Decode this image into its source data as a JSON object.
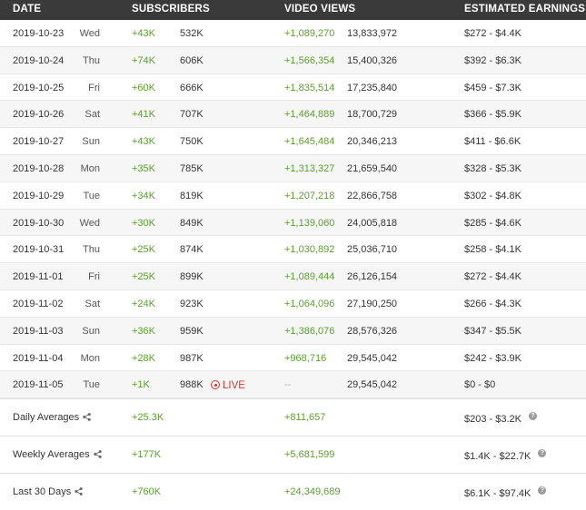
{
  "header": {
    "date": "DATE",
    "subscribers": "SUBSCRIBERS",
    "video_views": "VIDEO VIEWS",
    "estimated_earnings": "ESTIMATED EARNINGS"
  },
  "rows": [
    {
      "date": "2019-10-23",
      "day": "Wed",
      "subs_delta": "+43K",
      "subs_total": "532K",
      "live": "",
      "views_delta": "+1,089,270",
      "views_total": "13,833,972",
      "earnings": "$272  -  $4.4K"
    },
    {
      "date": "2019-10-24",
      "day": "Thu",
      "subs_delta": "+74K",
      "subs_total": "606K",
      "live": "",
      "views_delta": "+1,566,354",
      "views_total": "15,400,326",
      "earnings": "$392  -  $6.3K"
    },
    {
      "date": "2019-10-25",
      "day": "Fri",
      "subs_delta": "+60K",
      "subs_total": "666K",
      "live": "",
      "views_delta": "+1,835,514",
      "views_total": "17,235,840",
      "earnings": "$459  -  $7.3K"
    },
    {
      "date": "2019-10-26",
      "day": "Sat",
      "subs_delta": "+41K",
      "subs_total": "707K",
      "live": "",
      "views_delta": "+1,464,889",
      "views_total": "18,700,729",
      "earnings": "$366  -  $5.9K"
    },
    {
      "date": "2019-10-27",
      "day": "Sun",
      "subs_delta": "+43K",
      "subs_total": "750K",
      "live": "",
      "views_delta": "+1,645,484",
      "views_total": "20,346,213",
      "earnings": "$411  -  $6.6K"
    },
    {
      "date": "2019-10-28",
      "day": "Mon",
      "subs_delta": "+35K",
      "subs_total": "785K",
      "live": "",
      "views_delta": "+1,313,327",
      "views_total": "21,659,540",
      "earnings": "$328  -  $5.3K"
    },
    {
      "date": "2019-10-29",
      "day": "Tue",
      "subs_delta": "+34K",
      "subs_total": "819K",
      "live": "",
      "views_delta": "+1,207,218",
      "views_total": "22,866,758",
      "earnings": "$302  -  $4.8K"
    },
    {
      "date": "2019-10-30",
      "day": "Wed",
      "subs_delta": "+30K",
      "subs_total": "849K",
      "live": "",
      "views_delta": "+1,139,060",
      "views_total": "24,005,818",
      "earnings": "$285  -  $4.6K"
    },
    {
      "date": "2019-10-31",
      "day": "Thu",
      "subs_delta": "+25K",
      "subs_total": "874K",
      "live": "",
      "views_delta": "+1,030,892",
      "views_total": "25,036,710",
      "earnings": "$258  -  $4.1K"
    },
    {
      "date": "2019-11-01",
      "day": "Fri",
      "subs_delta": "+25K",
      "subs_total": "899K",
      "live": "",
      "views_delta": "+1,089,444",
      "views_total": "26,126,154",
      "earnings": "$272  -  $4.4K"
    },
    {
      "date": "2019-11-02",
      "day": "Sat",
      "subs_delta": "+24K",
      "subs_total": "923K",
      "live": "",
      "views_delta": "+1,064,096",
      "views_total": "27,190,250",
      "earnings": "$266  -  $4.3K"
    },
    {
      "date": "2019-11-03",
      "day": "Sun",
      "subs_delta": "+36K",
      "subs_total": "959K",
      "live": "",
      "views_delta": "+1,386,076",
      "views_total": "28,576,326",
      "earnings": "$347  -  $5.5K"
    },
    {
      "date": "2019-11-04",
      "day": "Mon",
      "subs_delta": "+28K",
      "subs_total": "987K",
      "live": "",
      "views_delta": "+968,716",
      "views_total": "29,545,042",
      "earnings": "$242  -  $3.9K"
    },
    {
      "date": "2019-11-05",
      "day": "Tue",
      "subs_delta": "+1K",
      "subs_total": "988K",
      "live": "LIVE",
      "views_delta": "--",
      "views_total": "29,545,042",
      "earnings": "$0  -  $0"
    }
  ],
  "averages": [
    {
      "label": "Daily Averages",
      "subs": "+25.3K",
      "views": "+811,657",
      "earnings": "$203  -  $3.2K"
    },
    {
      "label": "Weekly Averages",
      "subs": "+177K",
      "views": "+5,681,599",
      "earnings": "$1.4K  -  $22.7K"
    },
    {
      "label": "Last 30 Days",
      "subs": "+760K",
      "views": "+24,349,689",
      "earnings": "$6.1K  -  $97.4K"
    }
  ],
  "icons": {
    "share": "share-icon",
    "help": "help-icon",
    "live": "live-dot-icon"
  },
  "colors": {
    "positive": "#5aa02c",
    "live": "#d9382b",
    "header_bg": "#3a3a3a"
  },
  "help_glyph": "?"
}
